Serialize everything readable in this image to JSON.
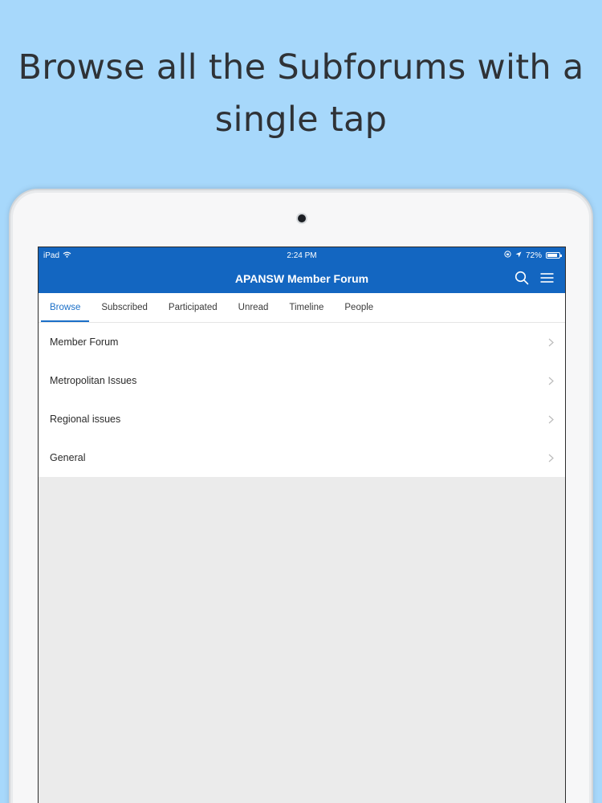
{
  "promo": {
    "line1": "Browse all the Subforums with a",
    "line2": "single tap"
  },
  "status": {
    "carrier": "iPad",
    "time": "2:24 PM",
    "battery_text": "72%"
  },
  "navbar": {
    "title": "APANSW Member Forum"
  },
  "tabs": [
    {
      "label": "Browse",
      "active": true
    },
    {
      "label": "Subscribed"
    },
    {
      "label": "Participated"
    },
    {
      "label": "Unread"
    },
    {
      "label": "Timeline"
    },
    {
      "label": "People"
    }
  ],
  "forums": [
    {
      "label": "Member Forum"
    },
    {
      "label": "Metropolitan Issues"
    },
    {
      "label": "Regional issues"
    },
    {
      "label": "General"
    }
  ],
  "colors": {
    "background": "#a7d8fb",
    "nav_blue": "#1366c1",
    "accent": "#1a6fc8"
  }
}
